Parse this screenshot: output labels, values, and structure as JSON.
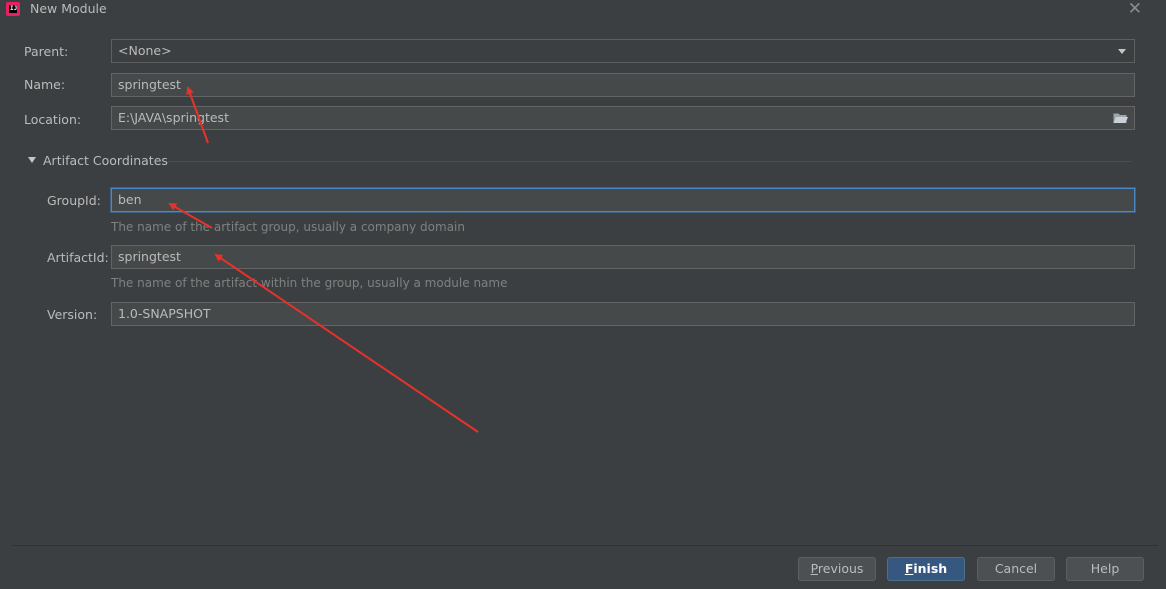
{
  "window": {
    "title": "New Module",
    "app_icon": "intellij-idea-icon",
    "close_icon": "close-icon"
  },
  "form": {
    "parent": {
      "label": "Parent:",
      "value": "<None>"
    },
    "name": {
      "label": "Name:",
      "value": "springtest"
    },
    "location": {
      "label": "Location:",
      "value": "E:\\JAVA\\springtest",
      "browse_icon": "folder-icon"
    }
  },
  "artifact_section": {
    "title": "Artifact Coordinates",
    "expanded": true,
    "group_id": {
      "label": "GroupId:",
      "value": "ben",
      "hint": "The name of the artifact group, usually a company domain"
    },
    "artifact_id": {
      "label": "ArtifactId:",
      "value": "springtest",
      "hint": "The name of the artifact within the group, usually a module name"
    },
    "version": {
      "label": "Version:",
      "value": "1.0-SNAPSHOT"
    }
  },
  "buttons": {
    "previous": {
      "mnemonic": "P",
      "rest": "revious"
    },
    "finish": {
      "mnemonic": "F",
      "rest": "inish"
    },
    "cancel": "Cancel",
    "help": "Help"
  },
  "annotation_color": "#e8312b"
}
